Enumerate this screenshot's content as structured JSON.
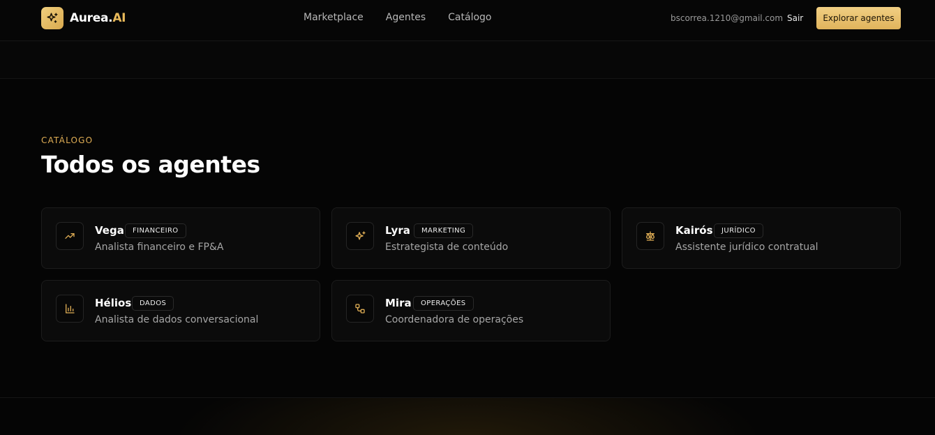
{
  "brand": {
    "name_main": "Aurea.",
    "name_accent": "AI",
    "icon": "sparkles-icon"
  },
  "nav": {
    "items": [
      {
        "label": "Marketplace"
      },
      {
        "label": "Agentes"
      },
      {
        "label": "Catálogo"
      }
    ]
  },
  "user": {
    "email": "bscorrea.1210@gmail.com",
    "logout_label": "Sair"
  },
  "cta": {
    "label": "Explorar agentes"
  },
  "section": {
    "eyebrow": "CATÁLOGO",
    "title": "Todos os agentes"
  },
  "agents": [
    {
      "name": "Vega",
      "tag": "FINANCEIRO",
      "description": "Analista financeiro e FP&A",
      "icon": "trending-up-icon"
    },
    {
      "name": "Lyra",
      "tag": "MARKETING",
      "description": "Estrategista de conteúdo",
      "icon": "sparkles-icon"
    },
    {
      "name": "Kairós",
      "tag": "JURÍDICO",
      "description": "Assistente jurídico contratual",
      "icon": "scale-icon"
    },
    {
      "name": "Hélios",
      "tag": "DADOS",
      "description": "Analista de dados conversacional",
      "icon": "bar-chart-icon"
    },
    {
      "name": "Mira",
      "tag": "OPERAÇÕES",
      "description": "Coordenadora de operações",
      "icon": "workflow-icon"
    }
  ],
  "colors": {
    "accent": "#E0AE55",
    "background": "#050505",
    "card": "#0B0B0B"
  }
}
